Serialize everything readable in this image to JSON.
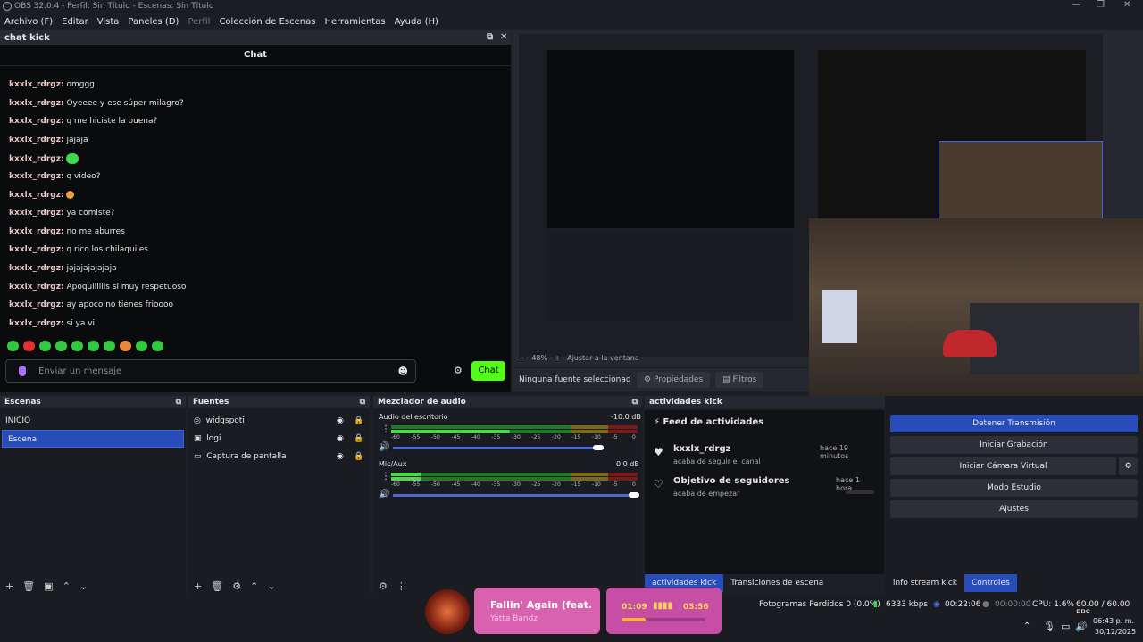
{
  "titlebar": {
    "title": "OBS 32.0.4 - Perfil: Sin Título - Escenas: Sin Título"
  },
  "menu": [
    "Archivo (F)",
    "Editar",
    "Vista",
    "Paneles (D)",
    "Perfil",
    "Colección de Escenas",
    "Herramientas",
    "Ayuda (H)"
  ],
  "chat_dock": {
    "title": "chat kick",
    "heading": "Chat"
  },
  "chat_messages": [
    {
      "user": "kxxlx_rdrgz:",
      "text": "omggg"
    },
    {
      "user": "kxxlx_rdrgz:",
      "text": "Oyeeee y ese súper milagro?"
    },
    {
      "user": "kxxlx_rdrgz:",
      "text": "q me hiciste la buena?"
    },
    {
      "user": "kxxlx_rdrgz:",
      "text": "jajaja"
    },
    {
      "user": "kxxlx_rdrgz:",
      "text": ""
    },
    {
      "user": "kxxlx_rdrgz:",
      "text": "q video?"
    },
    {
      "user": "kxxlx_rdrgz:",
      "text": ""
    },
    {
      "user": "kxxlx_rdrgz:",
      "text": "ya comiste?"
    },
    {
      "user": "kxxlx_rdrgz:",
      "text": "no me aburres"
    },
    {
      "user": "kxxlx_rdrgz:",
      "text": "q rico los chilaquiles"
    },
    {
      "user": "kxxlx_rdrgz:",
      "text": "jajajajajajaja"
    },
    {
      "user": "kxxlx_rdrgz:",
      "text": "Apoquiiiiiis si muy respetuoso"
    },
    {
      "user": "kxxlx_rdrgz:",
      "text": "ay apoco no tienes frioooo"
    },
    {
      "user": "kxxlx_rdrgz:",
      "text": "si ya vi"
    }
  ],
  "chat_input": {
    "placeholder": "Enviar un mensaje",
    "send_label": "Chat"
  },
  "preview": {
    "zoom": "48%",
    "fit": "Ajustar a la ventana",
    "no_source": "Ninguna fuente seleccionad",
    "props": "Propiedades",
    "filters": "Filtros"
  },
  "scenes": {
    "title": "Escenas",
    "items": [
      "INICIO",
      "Escena"
    ],
    "selected": 1
  },
  "sources": {
    "title": "Fuentes",
    "items": [
      "widgspoti",
      "logi",
      "Captura de pantalla"
    ]
  },
  "mixer": {
    "title": "Mezclador de audio",
    "channels": [
      {
        "name": "Audio del escritorio",
        "db": "-10.0 dB",
        "fader": 0.85
      },
      {
        "name": "Mic/Aux",
        "db": "0.0 dB",
        "fader": 1.0
      }
    ],
    "ticks": [
      "-60",
      "-55",
      "-50",
      "-45",
      "-40",
      "-35",
      "-30",
      "-25",
      "-20",
      "-15",
      "-10",
      "-5",
      "0"
    ]
  },
  "activity": {
    "title": "actividades kick",
    "feed_title": "Feed de actividades",
    "items": [
      {
        "name": "kxxlx_rdrgz",
        "sub": "acaba de seguir el canal",
        "time": "hace 19 minutos"
      },
      {
        "name": "Objetivo de seguidores",
        "sub": "acaba de empezar",
        "time": "hace 1 hora"
      }
    ]
  },
  "controls": {
    "stop_stream": "Detener Transmisión",
    "start_record": "Iniciar Grabación",
    "virtual_cam": "Iniciar Cámara Virtual",
    "studio": "Modo Estudio",
    "settings": "Ajustes"
  },
  "tabs_left": [
    "actividades kick",
    "Transiciones de escena"
  ],
  "tabs_right": [
    "info stream kick",
    "Controles"
  ],
  "status": {
    "dropped": "Fotogramas Perdidos 0 (0.0%)",
    "kbps": "6333 kbps",
    "stream_time": "00:22:06",
    "rec_time": "00:00:00",
    "cpu": "CPU: 1.6%",
    "fps": "60.00 / 60.00 FPS"
  },
  "media": {
    "title": "Fallin' Again (feat.",
    "artist": "Yatta Bandz",
    "elapsed": "01:09",
    "total": "03:56",
    "progress": 0.29
  },
  "clock": {
    "time": "06:43 p. m.",
    "date": "30/12/2025"
  },
  "colors": {
    "accent": "#284cb8",
    "kick_green": "#53fc18",
    "username": "#e8c7c7"
  }
}
